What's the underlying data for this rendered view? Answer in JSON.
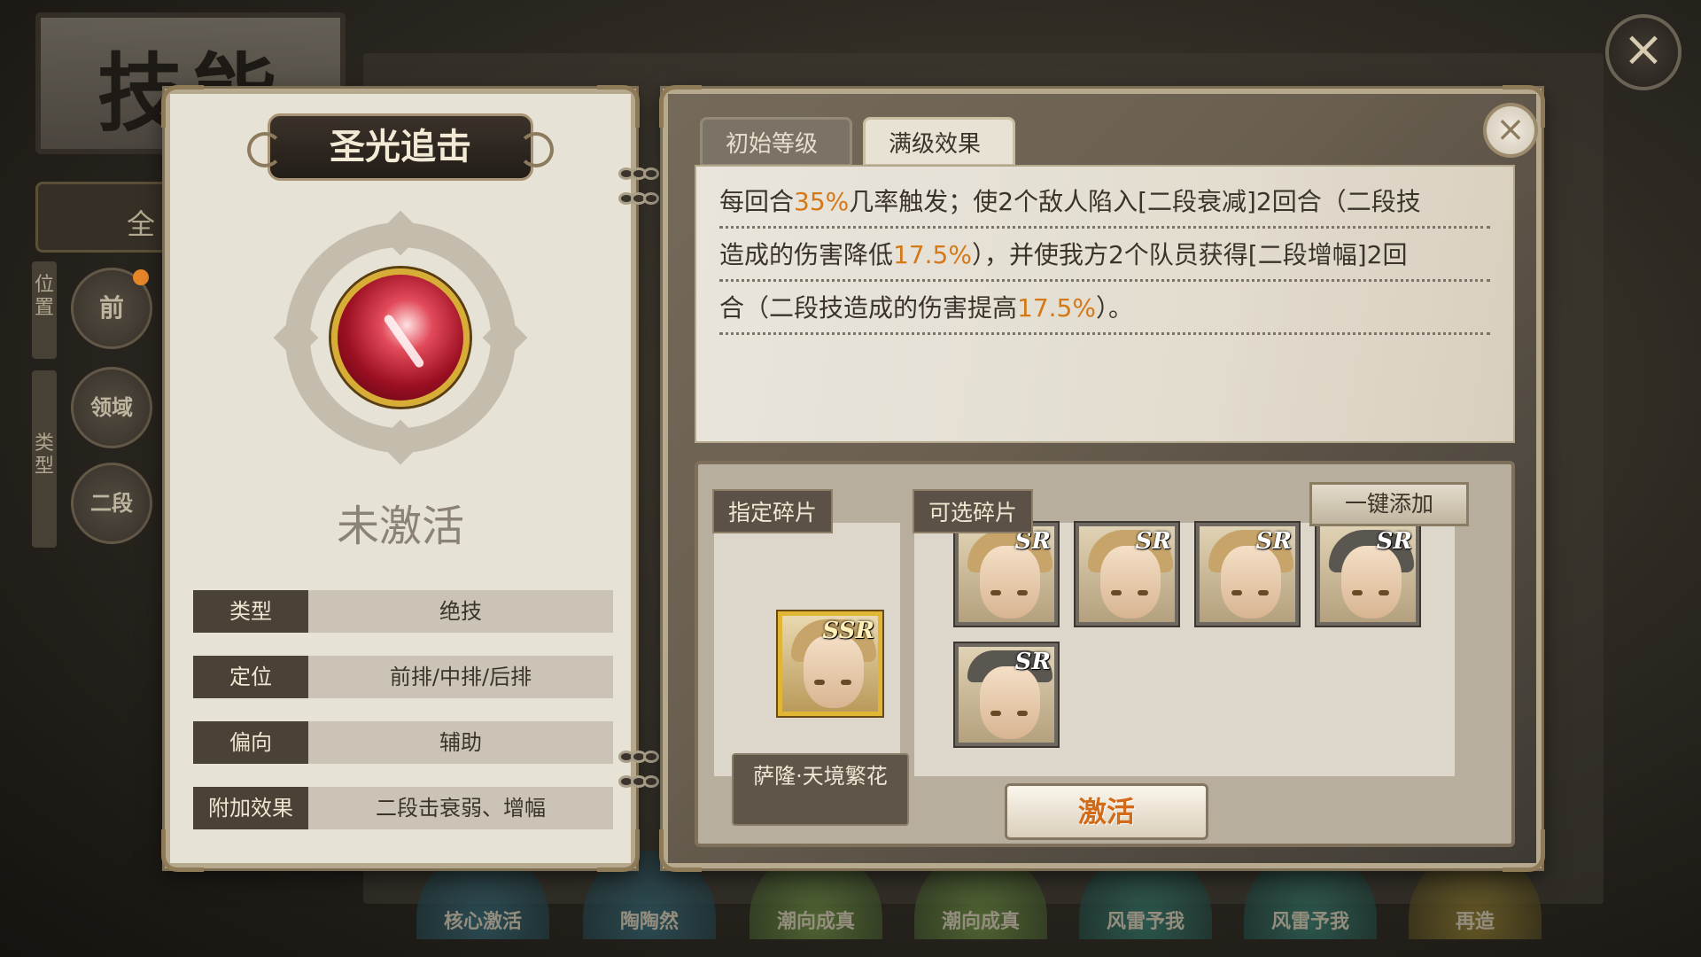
{
  "background": {
    "title": "技能",
    "all_button": "全",
    "position_label": "位置",
    "type_label": "类型",
    "filters": [
      "前",
      "领域",
      "二段"
    ],
    "bottom_orbs": [
      "核心激活",
      "陶陶然",
      "潮向成真",
      "潮向成真",
      "风雷予我",
      "风雷予我",
      "再造"
    ]
  },
  "skill_card": {
    "name": "圣光追击",
    "status": "未激活",
    "attributes": [
      {
        "key": "类型",
        "value": "绝技"
      },
      {
        "key": "定位",
        "value": "前排/中排/后排"
      },
      {
        "key": "偏向",
        "value": "辅助"
      },
      {
        "key": "附加效果",
        "value": "二段击衰弱、增幅"
      }
    ]
  },
  "detail": {
    "tabs": [
      "初始等级",
      "满级效果"
    ],
    "active_tab": "满级效果",
    "description_lines": [
      {
        "parts": [
          "每回合",
          "35%",
          "几率触发；使2个敌人陷入[二段衰减]2回合（二段技"
        ]
      },
      {
        "parts": [
          "造成的伤害降低",
          "17.5%",
          "），并使我方2个队员获得[二段增幅]2回"
        ]
      },
      {
        "parts": [
          "合（二段技造成的伤害提高",
          "17.5%",
          "）。"
        ]
      }
    ],
    "fixed_fragment_label": "指定碎片",
    "optional_fragment_label": "可选碎片",
    "one_click_add": "一键添加",
    "fixed_fragment": {
      "rarity": "SSR",
      "hero_name": "萨隆·天境繁花"
    },
    "optional_fragments": [
      {
        "rarity": "SR"
      },
      {
        "rarity": "SR"
      },
      {
        "rarity": "SR"
      },
      {
        "rarity": "SR"
      },
      {
        "rarity": "SR"
      }
    ],
    "activate_label": "激活"
  },
  "icons": {
    "close_outer": "×",
    "close_inner": "×"
  },
  "colors": {
    "highlight": "#d47818",
    "card_bg": "#e7e2d6",
    "label_dark": "#4a4137"
  }
}
